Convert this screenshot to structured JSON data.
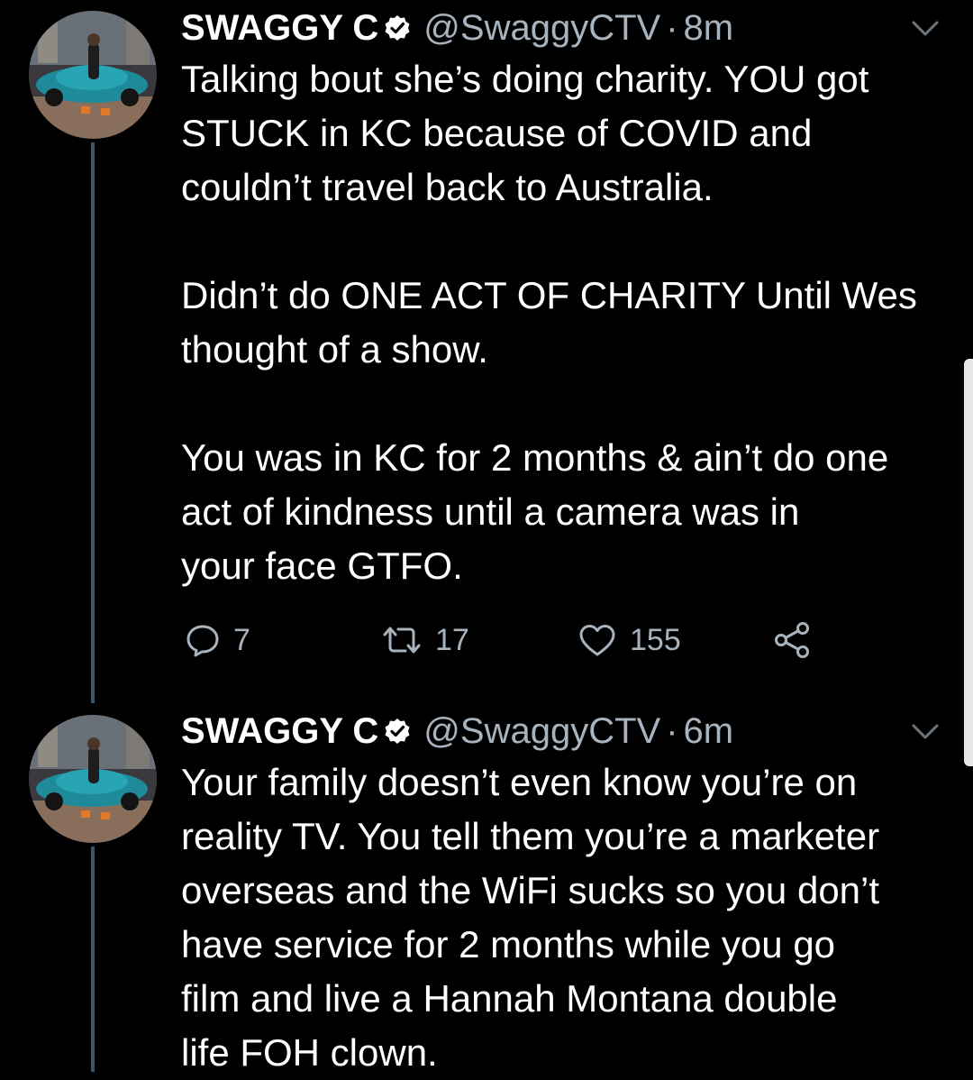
{
  "tweets": [
    {
      "author": {
        "display_name": "SWAGGY C",
        "handle": "@SwaggyCTV",
        "verified": true,
        "avatar_icon": "profile-photo-person-on-car"
      },
      "separator": "·",
      "time": "8m",
      "text": "Talking bout she’s doing charity. YOU got\nSTUCK in KC because of COVID and\ncouldn’t travel back to Australia.\n\nDidn’t do ONE ACT OF CHARITY Until Wes\nthought of a show.\n\nYou was in KC for 2 months & ain’t do one\nact of kindness until a camera was in\nyour face GTFO.",
      "actions": {
        "replies": "7",
        "retweets": "17",
        "likes": "155"
      }
    },
    {
      "author": {
        "display_name": "SWAGGY C",
        "handle": "@SwaggyCTV",
        "verified": true,
        "avatar_icon": "profile-photo-person-on-car"
      },
      "separator": "·",
      "time": "6m",
      "text": "Your family doesn’t even know you’re on\nreality TV. You tell them you’re a marketer\noverseas and the WiFi sucks so you don’t\nhave service for 2 months while you go\nfilm and live a Hannah Montana double\nlife FOH clown."
    }
  ],
  "colors": {
    "background": "#000000",
    "text": "#ffffff",
    "secondary_text": "#a8b3bd",
    "thread_line": "#3d5466",
    "verified_badge": "#ffffff"
  }
}
